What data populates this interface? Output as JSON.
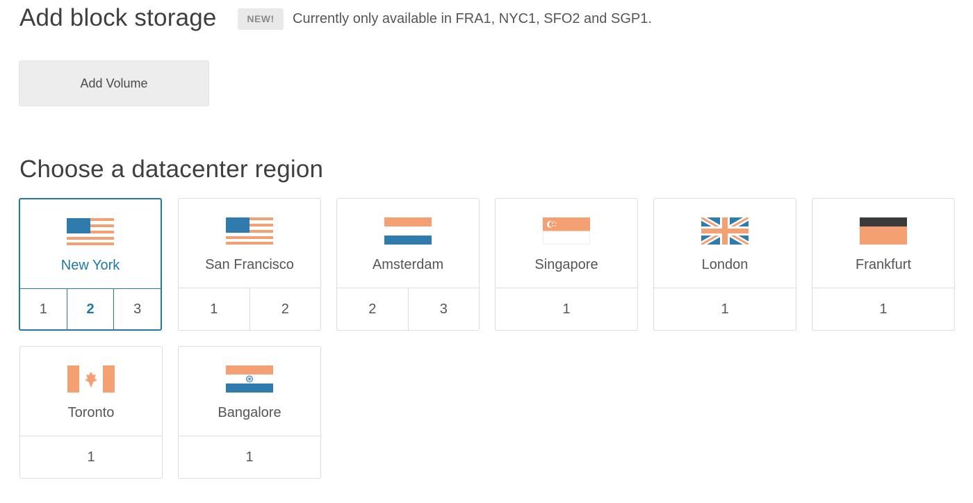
{
  "block_storage": {
    "title": "Add block storage",
    "badge": "NEW!",
    "note": "Currently only available in FRA1, NYC1, SFO2 and SGP1.",
    "add_volume_label": "Add Volume"
  },
  "region": {
    "title": "Choose a datacenter region",
    "selected_color": "#1f78a8",
    "flag_colors": {
      "orange": "#f5a072",
      "blue": "#2f7bad",
      "black": "#3b3b3b",
      "white": "#ffffff"
    },
    "datacenters": [
      {
        "name": "New York",
        "flag": "usa-flag-icon",
        "numbers": [
          "1",
          "2",
          "3"
        ],
        "selected": true,
        "active_number": "2"
      },
      {
        "name": "San Francisco",
        "flag": "usa-flag-icon",
        "numbers": [
          "1",
          "2"
        ]
      },
      {
        "name": "Amsterdam",
        "flag": "netherlands-flag-icon",
        "numbers": [
          "2",
          "3"
        ]
      },
      {
        "name": "Singapore",
        "flag": "singapore-flag-icon",
        "numbers": [
          "1"
        ]
      },
      {
        "name": "London",
        "flag": "uk-flag-icon",
        "numbers": [
          "1"
        ]
      },
      {
        "name": "Frankfurt",
        "flag": "germany-flag-icon",
        "numbers": [
          "1"
        ]
      },
      {
        "name": "Toronto",
        "flag": "canada-flag-icon",
        "numbers": [
          "1"
        ]
      },
      {
        "name": "Bangalore",
        "flag": "india-flag-icon",
        "numbers": [
          "1"
        ]
      }
    ]
  }
}
